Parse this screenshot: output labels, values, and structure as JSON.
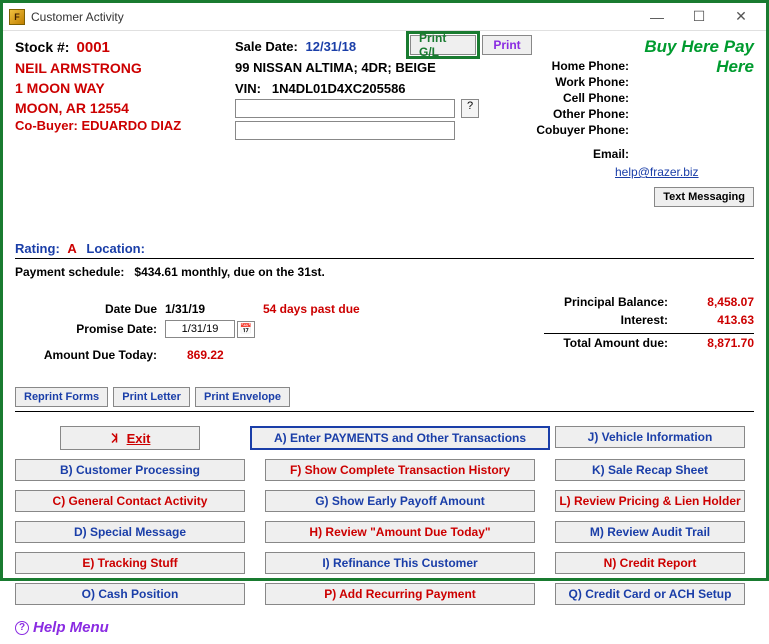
{
  "window": {
    "title": "Customer Activity"
  },
  "header": {
    "stock_label": "Stock #:",
    "stock_number": "0001",
    "customer_name": "NEIL ARMSTRONG",
    "address_line1": "1 MOON WAY",
    "address_line2": "MOON, AR 12554",
    "cobuyer_label": "Co-Buyer:",
    "cobuyer_name": "EDUARDO DIAZ",
    "sale_date_label": "Sale Date:",
    "sale_date": "12/31/18",
    "vehicle_desc": "99 NISSAN ALTIMA; 4DR; BEIGE",
    "vin_label": "VIN:",
    "vin": "1N4DL01D4XC205586",
    "print_gl": "Print G/L",
    "print": "Print",
    "buy_here": "Buy Here Pay Here",
    "phones": {
      "home": "Home Phone:",
      "work": "Work Phone:",
      "cell": "Cell Phone:",
      "other": "Other Phone:",
      "cobuyer": "Cobuyer Phone:"
    },
    "email_label": "Email:",
    "email_value": "help@frazer.biz",
    "text_messaging": "Text Messaging",
    "help_q": "?"
  },
  "rating": {
    "rating_label": "Rating:",
    "rating_value": "A",
    "location_label": "Location:"
  },
  "schedule": {
    "label": "Payment schedule:",
    "text": "$434.61 monthly, due on the 31st."
  },
  "due": {
    "date_due_label": "Date Due",
    "date_due": "1/31/19",
    "past_due": "54 days past due",
    "promise_label": "Promise Date:",
    "promise_date": "1/31/19",
    "amount_today_label": "Amount Due Today:",
    "amount_today": "869.22"
  },
  "balances": {
    "principal_label": "Principal Balance:",
    "principal": "8,458.07",
    "interest_label": "Interest:",
    "interest": "413.63",
    "total_label": "Total Amount due:",
    "total": "8,871.70"
  },
  "print_buttons": {
    "reprint": "Reprint Forms",
    "letter": "Print Letter",
    "envelope": "Print Envelope"
  },
  "actions": {
    "exit": "Exit",
    "enter_payments": "A) Enter PAYMENTS and Other Transactions",
    "vehicle_info": "J) Vehicle Information",
    "customer_processing": "B) Customer Processing",
    "show_history": "F) Show Complete Transaction History",
    "sale_recap": "K) Sale Recap Sheet",
    "contact_activity": "C) General Contact Activity",
    "early_payoff": "G) Show Early Payoff Amount",
    "pricing_lien": "L) Review Pricing & Lien Holder",
    "special_message": "D) Special Message",
    "review_amount": "H) Review \"Amount Due Today\"",
    "audit_trail": "M) Review Audit Trail",
    "tracking": "E) Tracking Stuff",
    "refinance": "I) Refinance This Customer",
    "credit_report": "N) Credit Report",
    "cash_position": "O) Cash Position",
    "recurring": "P) Add Recurring Payment",
    "cc_ach": "Q) Credit Card or ACH Setup"
  },
  "help_menu": "Help Menu"
}
